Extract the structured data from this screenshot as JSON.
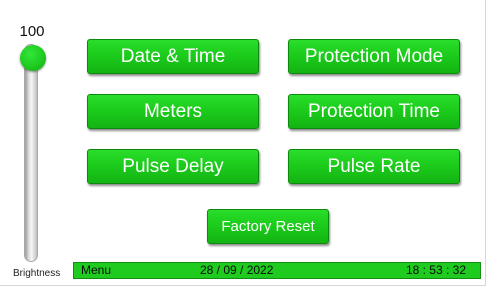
{
  "brightness": {
    "value": "100",
    "label": "Brightness",
    "level_fraction": 1.0
  },
  "buttons": {
    "date_time": "Date & Time",
    "protection_mode": "Protection Mode",
    "meters": "Meters",
    "protection_time": "Protection Time",
    "pulse_delay": "Pulse Delay",
    "pulse_rate": "Pulse Rate",
    "factory_reset": "Factory Reset"
  },
  "status_bar": {
    "menu": "Menu",
    "date": "28 / 09 / 2022",
    "time": "18 : 53 : 32"
  },
  "colors": {
    "accent_green": "#1fcb1f",
    "text_on_green": "#ffffff"
  }
}
